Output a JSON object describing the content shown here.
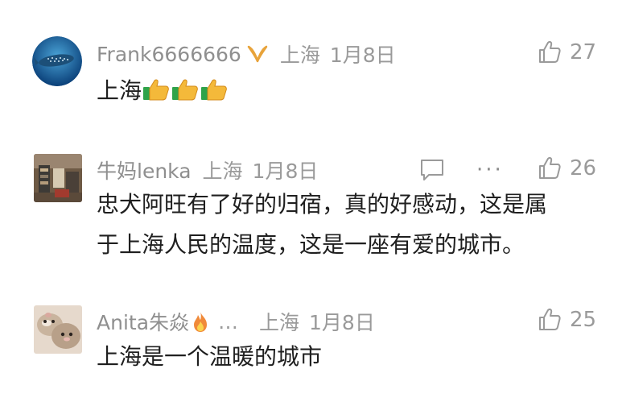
{
  "comments": [
    {
      "username": "Frank6666666",
      "location": "上海",
      "date": "1月8日",
      "text": "上海",
      "likes": "27",
      "thumbs_emoji_count": 3
    },
    {
      "username": "牛妈lenka",
      "location": "上海",
      "date": "1月8日",
      "text_line1": "忠犬阿旺有了好的归宿，真的好感动，这是属",
      "text_line2": "于上海人民的温度，这是一座有爱的城市。",
      "likes": "26",
      "more": "···"
    },
    {
      "username": "Anita朱焱",
      "ellipsis": "…",
      "location": "上海",
      "date": "1月8日",
      "text": "上海是一个温暖的城市",
      "likes": "25"
    }
  ],
  "colors": {
    "meta_text": "#9a9a9a",
    "body_text": "#1f1f1f",
    "badge_gold": "#e8a33a",
    "flame": "#f08a3a"
  }
}
